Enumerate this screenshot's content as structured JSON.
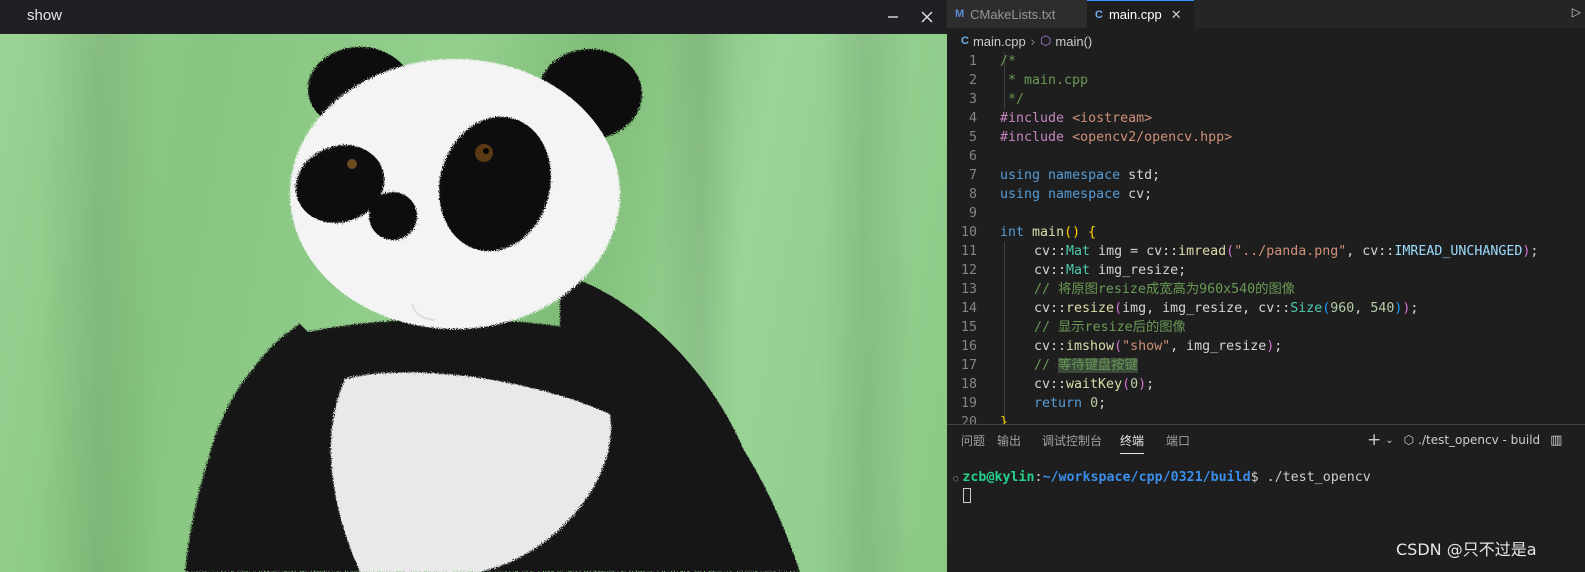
{
  "viewer": {
    "title": "show",
    "minimize_icon": "minimize-icon",
    "close_icon": "close-icon"
  },
  "editor": {
    "tabs": [
      {
        "label": "CMakeLists.txt",
        "icon": "M"
      },
      {
        "label": "main.cpp",
        "icon": "C",
        "close": "✕"
      }
    ],
    "breadcrumb": {
      "file": "main.cpp",
      "symbol": "main()"
    },
    "line_numbers": [
      "1",
      "2",
      "3",
      "4",
      "5",
      "6",
      "7",
      "8",
      "9",
      "10",
      "11",
      "12",
      "13",
      "14",
      "15",
      "16",
      "17",
      "18",
      "19",
      "20"
    ],
    "code": {
      "l1": "/*",
      "l2": " * main.cpp",
      "l3": " */",
      "l4_kw": "#include",
      "l4_inc": "<iostream>",
      "l5_kw": "#include",
      "l5_inc": "<opencv2/opencv.hpp>",
      "l7_a": "using",
      "l7_b": "namespace",
      "l7_c": "std;",
      "l8_a": "using",
      "l8_b": "namespace",
      "l8_c": "cv;",
      "l10_kw": "int",
      "l10_fn": "main",
      "l10_p": "()",
      "l10_b": "{",
      "l11_ns": "cv::",
      "l11_ty": "Mat",
      "l11_var": " img = cv::",
      "l11_fn": "imread",
      "l11_str": "\"../panda.png\"",
      "l11_rest": ", cv::",
      "l11_const": "IMREAD_UNCHANGED",
      "l12_ns": "cv::",
      "l12_ty": "Mat",
      "l12_var": " img_resize;",
      "l13": "// 将原图resize成宽高为960x540的图像",
      "l14_ns": "cv::",
      "l14_fn": "resize",
      "l14_a": "img, img_resize, cv::",
      "l14_ty": "Size",
      "l14_n1": "960",
      "l14_sep": ", ",
      "l14_n2": "540",
      "l15": "// 显示resize后的图像",
      "l16_ns": "cv::",
      "l16_fn": "imshow",
      "l16_str": "\"show\"",
      "l16_rest": ", img_resize",
      "l17_a": "// ",
      "l17_b": "等待键盘按键",
      "l18_ns": "cv::",
      "l18_fn": "waitKey",
      "l18_n": "0",
      "l19_kw": "return",
      "l19_n": "0",
      "l20": "}"
    }
  },
  "panel": {
    "tabs": [
      "问题",
      "输出",
      "调试控制台",
      "终端",
      "端口"
    ],
    "active_tab": "终端",
    "terminal_name": "./test_opencv - build",
    "prompt_user": "zcb@kylin",
    "prompt_path": "~/workspace/cpp/0321/build",
    "prompt_cmd": "$ ./test_opencv"
  },
  "watermark": "CSDN @只不过是a",
  "colors": {
    "editor_bg": "#1e1e1e",
    "accent": "#3794ff",
    "backdrop_green": "#8fc98a"
  }
}
